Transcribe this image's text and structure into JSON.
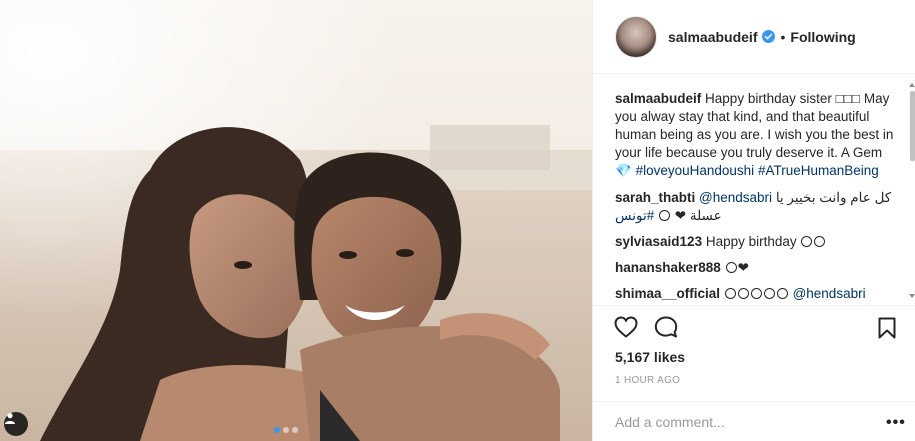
{
  "post": {
    "username": "salmaabudeif",
    "separator": "•",
    "follow_label": "Following",
    "verified": true
  },
  "caption": {
    "username": "salmaabudeif",
    "text": "Happy birthday sister □□□ May you alway stay that kind, and that beautiful human being as you are. I wish you the best in your life because you truly deserve it. A Gem 💎",
    "hashtag1": "#loveyouHandoushi",
    "hashtag2": "#ATrueHumanBeing"
  },
  "comments": [
    {
      "username": "sarah_thabti",
      "mention": "@hendsabri",
      "text": "كل عام وانت بخيير يا عسلة",
      "hashtag": "#تونس"
    },
    {
      "username": "sylviasaid123",
      "text": "Happy birthday"
    },
    {
      "username": "hananshaker888",
      "text": ""
    },
    {
      "username": "shimaa__official",
      "mention": "@hendsabri"
    }
  ],
  "stats": {
    "likes": "5,167 likes",
    "time": "1 HOUR AGO"
  },
  "compose": {
    "placeholder": "Add a comment...",
    "more_label": "•••"
  },
  "carousel": {
    "count": 3,
    "active_index": 0
  },
  "icons": {
    "like": "heart-outline-icon",
    "comment": "speech-bubble-icon",
    "save": "bookmark-icon",
    "tagged": "person-tag-icon",
    "verified": "verified-badge-icon"
  },
  "colors": {
    "accent": "#3897f0",
    "text": "#262626",
    "muted": "#999999",
    "hashtag": "#003569"
  }
}
